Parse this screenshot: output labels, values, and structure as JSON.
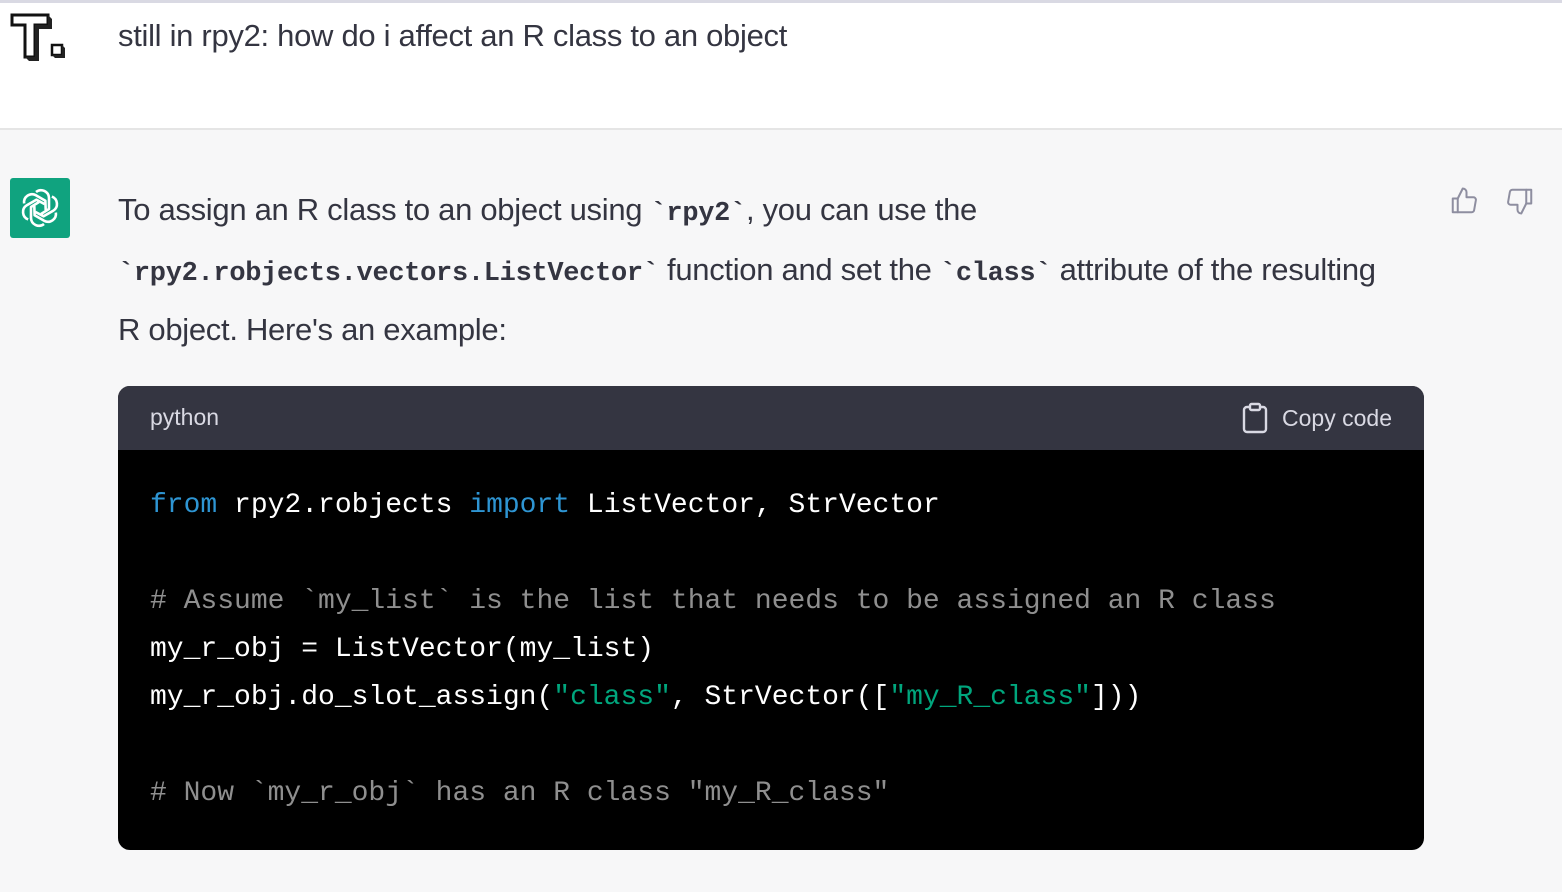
{
  "user": {
    "message": "still in rpy2: how do i affect an R class to an object"
  },
  "assistant": {
    "intro_1": "To assign an R class to an object using ",
    "code_1": "`rpy2`",
    "intro_2": ", you can use the ",
    "code_2": "`rpy2.robjects.vectors.ListVector`",
    "intro_3": " function and set the ",
    "code_3": "`class`",
    "intro_4": " attribute of the resulting R object. Here's an example:"
  },
  "code_block": {
    "language": "python",
    "copy_label": "Copy code",
    "lines": {
      "l1_kw1": "from",
      "l1_mid": " rpy2.robjects ",
      "l1_kw2": "import",
      "l1_end": " ListVector, StrVector",
      "l3_comment": "# Assume `my_list` is the list that needs to be assigned an R class",
      "l4": "my_r_obj = ListVector(my_list)",
      "l5_a": "my_r_obj.do_slot_assign(",
      "l5_s1": "\"class\"",
      "l5_b": ", StrVector([",
      "l5_s2": "\"my_R_class\"",
      "l5_c": "]))",
      "l7_comment": "# Now `my_r_obj` has an R class \"my_R_class\""
    }
  },
  "icons": {
    "user_avatar": "user-avatar-icon",
    "assistant_avatar": "openai-logo-icon",
    "thumbs_up": "thumbs-up-icon",
    "thumbs_down": "thumbs-down-icon",
    "clipboard": "clipboard-icon"
  },
  "colors": {
    "assistant_avatar_bg": "#10a37f",
    "code_bg": "#000000",
    "code_header_bg": "#343541",
    "keyword": "#2e95d3",
    "string": "#00a67d",
    "comment": "#8f8f8f"
  }
}
